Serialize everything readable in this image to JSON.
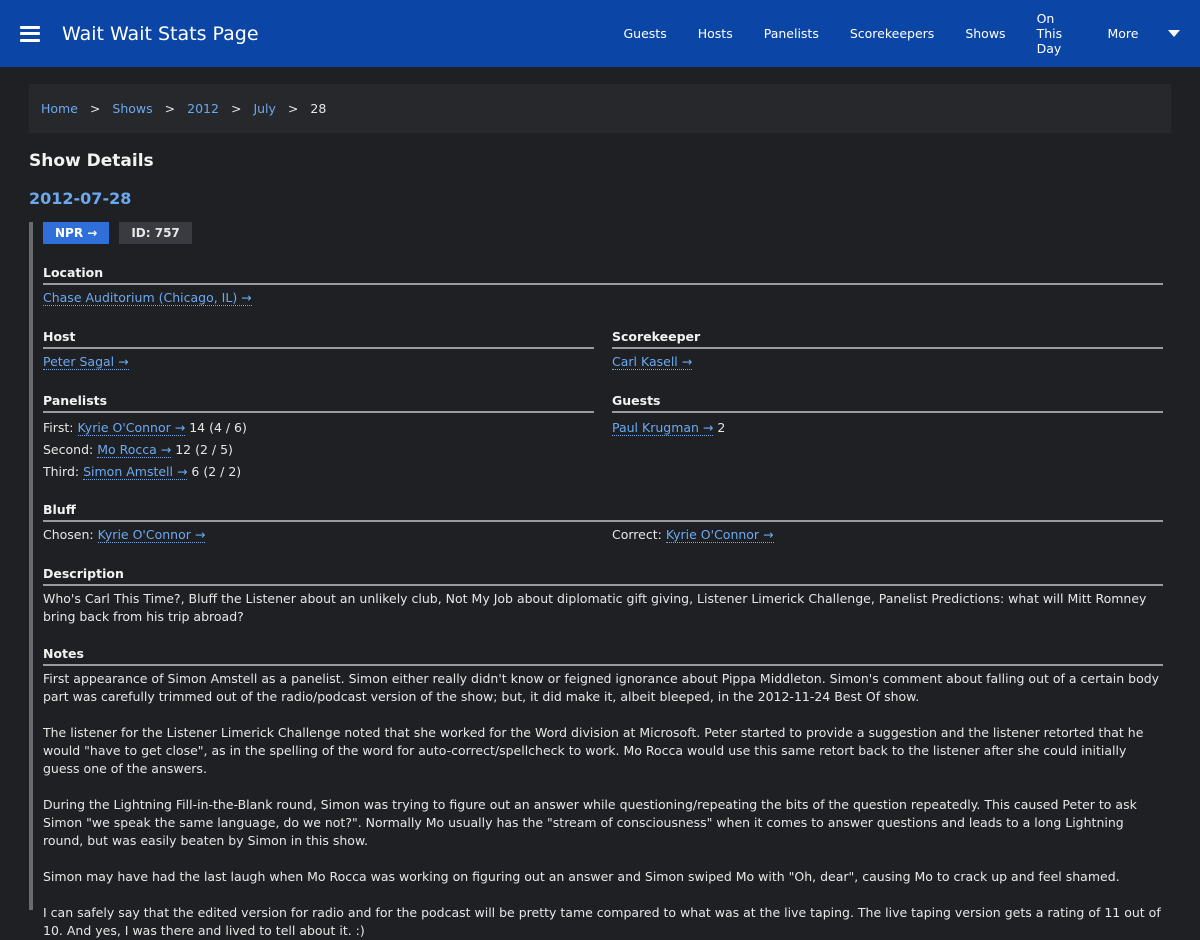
{
  "header": {
    "title": "Wait Wait Stats Page",
    "nav": [
      "Guests",
      "Hosts",
      "Panelists",
      "Scorekeepers",
      "Shows",
      "On This Day",
      "More"
    ]
  },
  "breadcrumb": {
    "items": [
      "Home",
      "Shows",
      "2012",
      "July"
    ],
    "separator": ">",
    "current": "28"
  },
  "page_title": "Show Details",
  "show": {
    "date": "2012-07-28",
    "npr_label": "NPR →",
    "id_label": "ID: 757"
  },
  "location": {
    "title": "Location",
    "value": "Chase Auditorium (Chicago, IL) →"
  },
  "host": {
    "title": "Host",
    "value": "Peter Sagal →"
  },
  "scorekeeper": {
    "title": "Scorekeeper",
    "value": "Carl Kasell →"
  },
  "panelists": {
    "title": "Panelists",
    "rows": [
      {
        "label": "First:",
        "name": "Kyrie O'Connor →",
        "score": " 14 (4 / 6)"
      },
      {
        "label": "Second:",
        "name": "Mo Rocca →",
        "score": " 12 (2 / 5)"
      },
      {
        "label": "Third:",
        "name": "Simon Amstell →",
        "score": " 6 (2 / 2)"
      }
    ]
  },
  "guests": {
    "title": "Guests",
    "name": "Paul Krugman →",
    "score": " 2"
  },
  "bluff": {
    "title": "Bluff",
    "chosen_label": "Chosen:",
    "chosen": "Kyrie O'Connor →",
    "correct_label": "Correct:",
    "correct": "Kyrie O'Connor →"
  },
  "description": {
    "title": "Description",
    "text": "Who's Carl This Time?, Bluff the Listener about an unlikely club, Not My Job about diplomatic gift giving, Listener Limerick Challenge, Panelist Predictions: what will Mitt Romney bring back from his trip abroad?"
  },
  "notes": {
    "title": "Notes",
    "paragraphs": [
      "First appearance of Simon Amstell as a panelist. Simon either really didn't know or feigned ignorance about Pippa Middleton. Simon's comment about falling out of a certain body part was carefully trimmed out of the radio/podcast version of the show; but, it did make it, albeit bleeped, in the 2012-11-24 Best Of show.",
      "The listener for the Listener Limerick Challenge noted that she worked for the Word division at Microsoft. Peter started to provide a suggestion and the listener retorted that he would \"have to get close\", as in the spelling of the word for auto-correct/spellcheck to work. Mo Rocca would use this same retort back to the listener after she could initially guess one of the answers.",
      "During the Lightning Fill-in-the-Blank round, Simon was trying to figure out an answer while questioning/repeating the bits of the question repeatedly. This caused Peter to ask Simon \"we speak the same language, do we not?\". Normally Mo usually has the \"stream of consciousness\" when it comes to answer questions and leads to a long Lightning round, but was easily beaten by Simon in this show.",
      "Simon may have had the last laugh when Mo Rocca was working on figuring out an answer and Simon swiped Mo with \"Oh, dear\", causing Mo to crack up and feel shamed.",
      "I can safely say that the edited version for radio and for the podcast will be pretty tame compared to what was at the live taping. The live taping version gets a rating of 11 out of 10. And yes, I was there and lived to tell about it. :)"
    ]
  }
}
